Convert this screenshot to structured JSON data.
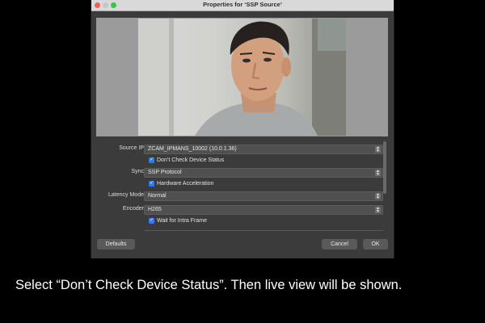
{
  "window": {
    "title": "Properties for ‘SSP Source’"
  },
  "preview": {
    "description_icon": "camera-live-view"
  },
  "form": {
    "source_ip": {
      "label": "Source IP",
      "value": "ZCAM_IPMANS_10002 (10.0.1.36)"
    },
    "dont_check": {
      "label": "Don’t Check Device Status",
      "checked": true
    },
    "sync": {
      "label": "Sync",
      "value": "SSP Protocol"
    },
    "hw_accel": {
      "label": "Hardware Acceleration",
      "checked": true
    },
    "latency": {
      "label": "Latency Mode",
      "value": "Normal"
    },
    "encoder": {
      "label": "Encoder",
      "value": "H265"
    },
    "intra": {
      "label": "Wait for Intra Frame",
      "checked": true
    }
  },
  "buttons": {
    "defaults": "Defaults",
    "cancel": "Cancel",
    "ok": "OK"
  },
  "caption": "Select “Don’t Check Device Status”. Then live view will be shown.",
  "colors": {
    "checkbox": "#2f7bf4",
    "window_bg": "#3b3b3b",
    "close": "#ee5f57",
    "maximize": "#33c748"
  }
}
